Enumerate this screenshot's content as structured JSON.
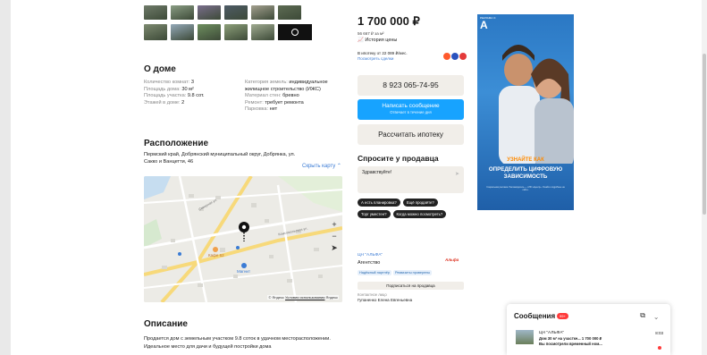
{
  "photos": {
    "row1_colors": [
      "#6f7b6a",
      "#8a9d84",
      "#7a6e8c",
      "#4e5b66",
      "#a3a08f",
      "#5d6b53"
    ],
    "row2_colors": [
      "#7d8a70",
      "#94a9b8",
      "#6e8f5f",
      "#8da07a",
      "#a0ab91"
    ]
  },
  "about": {
    "title": "О доме",
    "left": [
      {
        "label": "Количество комнат: ",
        "value": "3"
      },
      {
        "label": "Площадь дома: ",
        "value": "30 м²"
      },
      {
        "label": "Площадь участка: ",
        "value": "9.8 сот."
      },
      {
        "label": "Этажей в доме: ",
        "value": "2"
      }
    ],
    "right": [
      {
        "label": "Категория земель: ",
        "value": "индивидуальное жилищное строительство (ИЖС)"
      },
      {
        "label": "Материал стен: ",
        "value": "бревно"
      },
      {
        "label": "Ремонт: ",
        "value": "требует ремонта"
      },
      {
        "label": "Парковка: ",
        "value": "нет"
      }
    ]
  },
  "location": {
    "title": "Расположение",
    "address": "Пермский край, Добрянский муниципальный округ, Добрянка, ул. Сакко и Ванцетти, 46",
    "hide_map": "Скрыть карту ⌃",
    "map_copyright_prefix": "© Яндекс ",
    "map_terms": "Условия использования",
    "map_brand": " Яндекс",
    "poi_cafe": "Кафе 62",
    "poi_shop": "Магнит",
    "street1": "Комсомольская ул.",
    "street2": "Северная ул."
  },
  "description": {
    "title": "Описание",
    "text": "Продается дом с земельным участком 9.8 соток в удачном месторасположении. Идеальное место для дачи и будущей постройки дома"
  },
  "price": {
    "main": "1 700 000 ₽",
    "per_m2": "56 667 ₽ за м²",
    "history": "📈 История цены",
    "mortgage": "В ипотеку от 22 089 ₽/мес.",
    "mortgage_link": "Посмотреть сделки"
  },
  "buttons": {
    "phone": "8 923 065-74-95",
    "write": "Написать сообщение",
    "write_sub": "Отвечает в течение дня",
    "mortgage": "Рассчитать ипотеку"
  },
  "ask": {
    "title": "Спросите у продавца",
    "greeting": "Здравствуйте!",
    "chips": [
      "А есть планировка?",
      "Ещё продаёте?",
      "Торг уместен?",
      "Когда можно посмотреть?"
    ]
  },
  "seller": {
    "name": "ЦН \"АЛЬФА\"",
    "type": "Агентство",
    "logo": "Альфа",
    "tags": [
      "Надёжный партнёр",
      "Реквизиты проверены"
    ],
    "subscribe": "Подписаться на продавца",
    "contact_label": "Контактное лицо",
    "contact_name": "Гупаненко Елена Евгеньевна"
  },
  "ad": {
    "brand": "РЕКЛАМА ⊙",
    "logo": "А",
    "orange": "УЗНАЙТЕ КАК",
    "white": "ОПРЕДЕЛИТЬ ЦИФРОВУЮ ЗАВИСИМОСТЬ",
    "small": "Социальная реклама. Рекламодатель — АНО «Центр». Узнайте подробнее на сайте."
  },
  "messages": {
    "title": "Сообщения",
    "count": "99+",
    "icons": "⧉ ⌄",
    "item_name": "ЦН \"АЛЬФА\"",
    "item_line1": "Дом 30 м² на участке...  1 700 000 ₽",
    "item_line2": "Вы посмотрели временный ном...",
    "item_time": "8:03"
  },
  "colors": {
    "accent_blue": "#17a3ff",
    "link_blue": "#3a7bd5",
    "orange": "#ff8a00",
    "red": "#ff3b3b"
  }
}
